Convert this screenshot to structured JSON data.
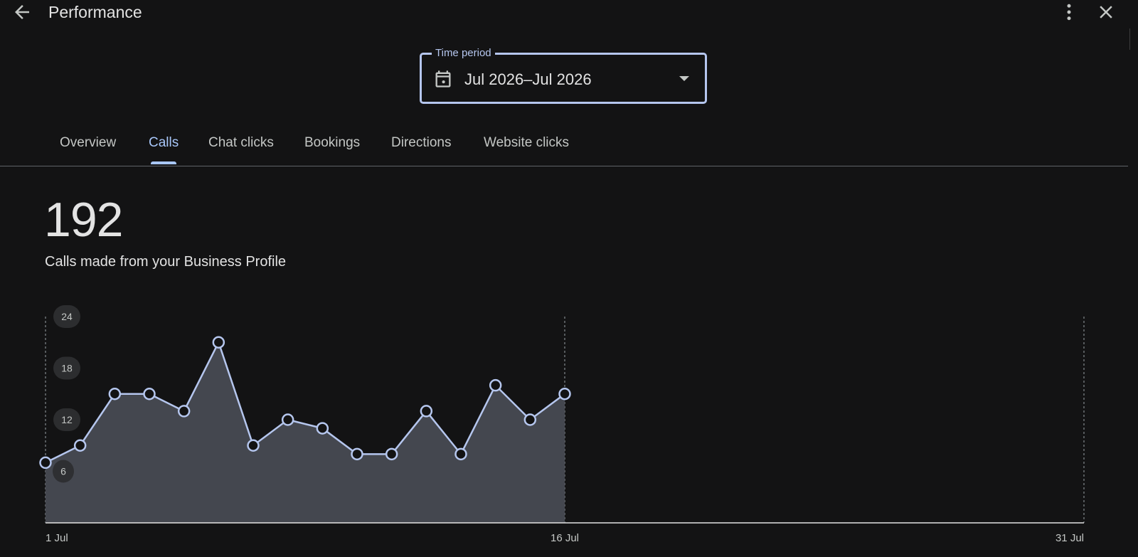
{
  "header": {
    "title": "Performance",
    "back_icon": "arrow-back-icon",
    "more_icon": "more-vert-icon",
    "close_icon": "close-icon"
  },
  "time_period": {
    "label": "Time period",
    "value": "Jul 2026–Jul 2026",
    "calendar_icon": "calendar-icon",
    "dropdown_icon": "caret-down-icon"
  },
  "tabs": [
    {
      "label": "Overview",
      "active": false
    },
    {
      "label": "Calls",
      "active": true
    },
    {
      "label": "Chat clicks",
      "active": false
    },
    {
      "label": "Bookings",
      "active": false
    },
    {
      "label": "Directions",
      "active": false
    },
    {
      "label": "Website clicks",
      "active": false
    }
  ],
  "metric": {
    "value": "192",
    "label": "Calls made from your Business Profile"
  },
  "colors": {
    "background": "#131314",
    "accent": "#a8c7fa",
    "line": "#b5c6ee",
    "area_fill": "#474a52"
  },
  "chart_data": {
    "type": "area",
    "x": [
      1,
      2,
      3,
      4,
      5,
      6,
      7,
      8,
      9,
      10,
      11,
      12,
      13,
      14,
      15,
      16
    ],
    "x_domain": [
      1,
      31
    ],
    "values": [
      7,
      9,
      15,
      15,
      13,
      21,
      9,
      12,
      11,
      8,
      8,
      13,
      8,
      16,
      12,
      15
    ],
    "ylim": [
      0,
      24
    ],
    "y_ticks": [
      "24",
      "18",
      "12",
      "6"
    ],
    "x_ticks": [
      {
        "day": 1,
        "label": "1 Jul"
      },
      {
        "day": 16,
        "label": "16 Jul"
      },
      {
        "day": 31,
        "label": "31 Jul"
      }
    ],
    "grid": false
  }
}
